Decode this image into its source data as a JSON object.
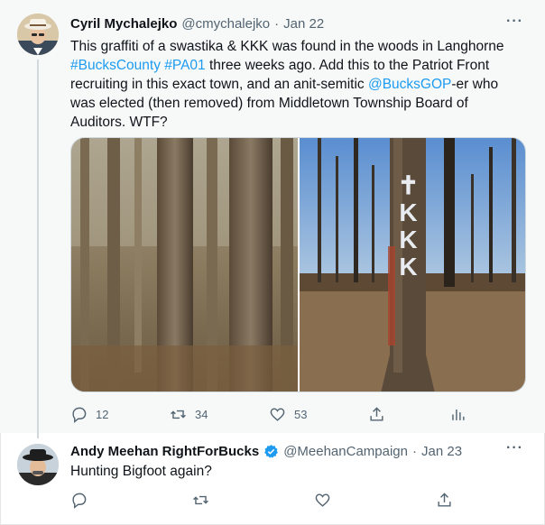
{
  "tweet": {
    "author_name": "Cyril Mychalejko",
    "handle": "@cmychalejko",
    "separator": "·",
    "date": "Jan 22",
    "more_icon": "more-icon",
    "text_parts": {
      "p1": "This graffiti of a swastika & KKK was found in the woods in Langhorne ",
      "tag1": "#BucksCounty",
      "space1": " ",
      "tag2": "#PA01",
      "p2": " three weeks ago. Add this to the Patriot Front recruiting in this exact town, and an anit-semitic ",
      "mention": "@BucksGOP",
      "p3": "-er who was elected (then removed) from Middletown Township Board of Auditors. WTF?"
    },
    "media": [
      {
        "name": "woods-trees-photo"
      },
      {
        "name": "kkk-graffiti-tree-photo",
        "graffiti": "✝KKK"
      }
    ],
    "actions": {
      "replies": "12",
      "retweets": "34",
      "likes": "53"
    }
  },
  "reply": {
    "author_name": "Andy Meehan RightForBucks",
    "handle": "@MeehanCampaign",
    "separator": "·",
    "date": "Jan 23",
    "text": "Hunting Bigfoot again?"
  },
  "colors": {
    "link": "#1d9bf0",
    "muted": "#536471",
    "verified": "#1d9bf0"
  }
}
